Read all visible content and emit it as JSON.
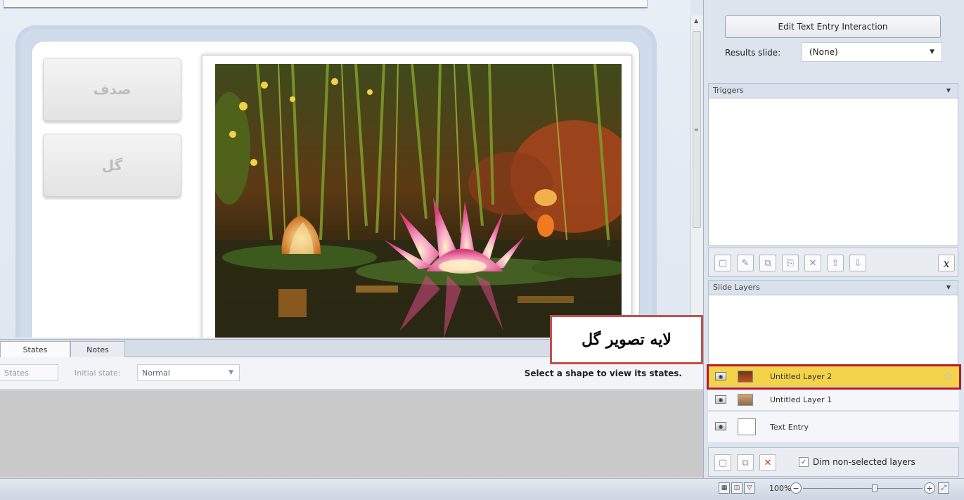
{
  "slide": {
    "choice_1": "صدف",
    "choice_2": "گل"
  },
  "tabs": {
    "states": "States",
    "notes": "Notes"
  },
  "states_panel": {
    "edit_states": "States",
    "initial_state_label": "Initial state:",
    "initial_state_value": "Normal",
    "hint": "Select a shape to view its states."
  },
  "callout": {
    "text": "لایه تصویر گل",
    "border_color": "#c0504d"
  },
  "right_panel": {
    "edit_interaction_label": "Edit Text Entry Interaction",
    "results_label": "Results slide:",
    "results_value": "(None)",
    "triggers_title": "Triggers",
    "slide_layers_title": "Slide Layers",
    "layers": [
      {
        "name": "Untitled Layer 2",
        "selected": true
      },
      {
        "name": "Untitled Layer 1",
        "selected": false
      },
      {
        "name": "Text Entry",
        "selected": false
      }
    ],
    "dim_label": "Dim non-selected layers",
    "dim_checked": true,
    "highlight_color": "#b8192a"
  },
  "zoom": {
    "percent": "100%"
  }
}
